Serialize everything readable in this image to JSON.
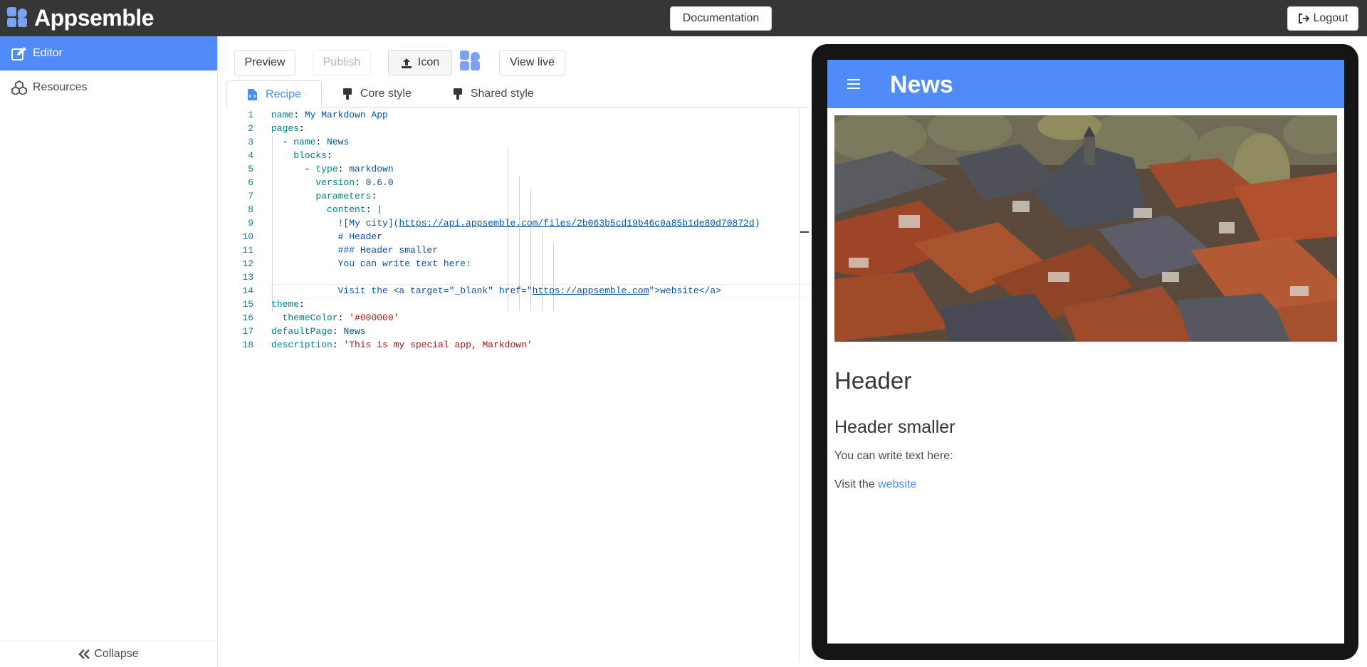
{
  "navbar": {
    "brand": "Appsemble",
    "documentation_label": "Documentation",
    "logout_label": "Logout"
  },
  "sidebar": {
    "items": [
      {
        "label": "Editor",
        "icon": "edit-icon",
        "active": true
      },
      {
        "label": "Resources",
        "icon": "cubes-icon",
        "active": false
      }
    ],
    "collapse_label": "Collapse"
  },
  "toolbar": {
    "preview_label": "Preview",
    "publish_label": "Publish",
    "icon_label": "Icon",
    "view_live_label": "View live"
  },
  "tabs": [
    {
      "label": "Recipe",
      "icon": "file-code-icon",
      "active": true
    },
    {
      "label": "Core style",
      "icon": "paint-brush-icon",
      "active": false
    },
    {
      "label": "Shared style",
      "icon": "paint-brush-icon",
      "active": false
    }
  ],
  "editor": {
    "current_line": 14,
    "lines": [
      {
        "n": "1",
        "t": "name: My Markdown App"
      },
      {
        "n": "2",
        "t": "pages:"
      },
      {
        "n": "3",
        "t": "  - name: News"
      },
      {
        "n": "4",
        "t": "    blocks:"
      },
      {
        "n": "5",
        "t": "      - type: markdown"
      },
      {
        "n": "6",
        "t": "        version: 0.6.0"
      },
      {
        "n": "7",
        "t": "        parameters:"
      },
      {
        "n": "8",
        "t": "          content: |"
      },
      {
        "n": "9",
        "t": "            ![My city](https://api.appsemble.com/files/2b063b5cd19b46c0a85b1de80d70872d)"
      },
      {
        "n": "10",
        "t": "            # Header"
      },
      {
        "n": "11",
        "t": "            ### Header smaller"
      },
      {
        "n": "12",
        "t": "            You can write text here:"
      },
      {
        "n": "13",
        "t": ""
      },
      {
        "n": "14",
        "t": "            Visit the <a target=\"_blank\" href=\"https://appsemble.com\">website</a>"
      },
      {
        "n": "15",
        "t": "theme:"
      },
      {
        "n": "16",
        "t": "  themeColor: '#000000'"
      },
      {
        "n": "17",
        "t": "defaultPage: News"
      },
      {
        "n": "18",
        "t": "description: 'This is my special app, Markdown'"
      }
    ]
  },
  "preview": {
    "app_title": "News",
    "heading": "Header",
    "subheading": "Header smaller",
    "paragraph": "You can write text here:",
    "visit_prefix": "Visit the ",
    "visit_link": "website",
    "photo_alt": "My city"
  },
  "colors": {
    "primary": "#4f8cf7",
    "navbar": "#363636",
    "device_frame": "#141414"
  }
}
